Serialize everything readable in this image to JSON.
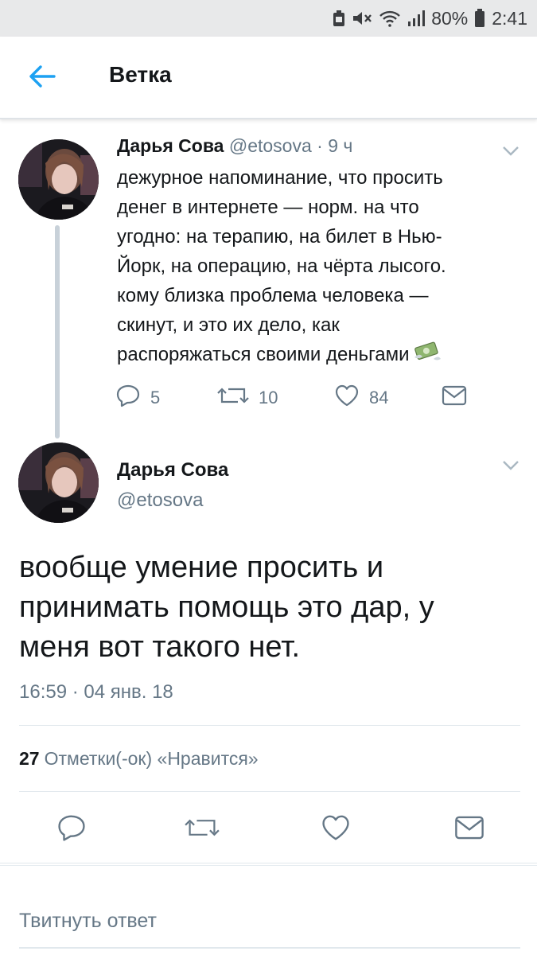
{
  "status_bar": {
    "battery": "80%",
    "time": "2:41",
    "icons": [
      "notification-icon",
      "mute-icon",
      "wifi-icon",
      "signal-icon",
      "battery-icon"
    ]
  },
  "header": {
    "title": "Ветка",
    "back_icon": "arrow-left-icon"
  },
  "tweet_parent": {
    "author_name": "Дарья Сова",
    "handle": "@etosova",
    "separator": "·",
    "age": "9 ч",
    "lines": [
      "дежурное напоминание, что просить",
      "денег в интернете — норм. на что",
      "угодно: на терапию, на билет в Нью-",
      "Йорк, на операцию, на чёрта лысого.",
      "кому близка проблема человека —",
      "скинут, и это их дело, как",
      "распоряжаться своими деньгами"
    ],
    "emoji_icon": "money-with-wings-icon",
    "replies": "5",
    "retweets": "10",
    "likes": "84"
  },
  "tweet_main": {
    "author_name": "Дарья Сова",
    "handle": "@etosova",
    "lines": [
      "вообще умение просить и",
      "принимать помощь это дар, у",
      "меня вот такого нет."
    ],
    "timestamp": "16:59 · 04 янв. 18",
    "likes_count": "27",
    "likes_label": "Отметки(-ок) «Нравится»"
  },
  "reply": {
    "placeholder": "Твитнуть ответ"
  },
  "colors": {
    "accent": "#1da1f2",
    "muted": "#657786",
    "text": "#14171a",
    "divider": "#e1e8ed",
    "status_bar": "#e8e9ea"
  }
}
